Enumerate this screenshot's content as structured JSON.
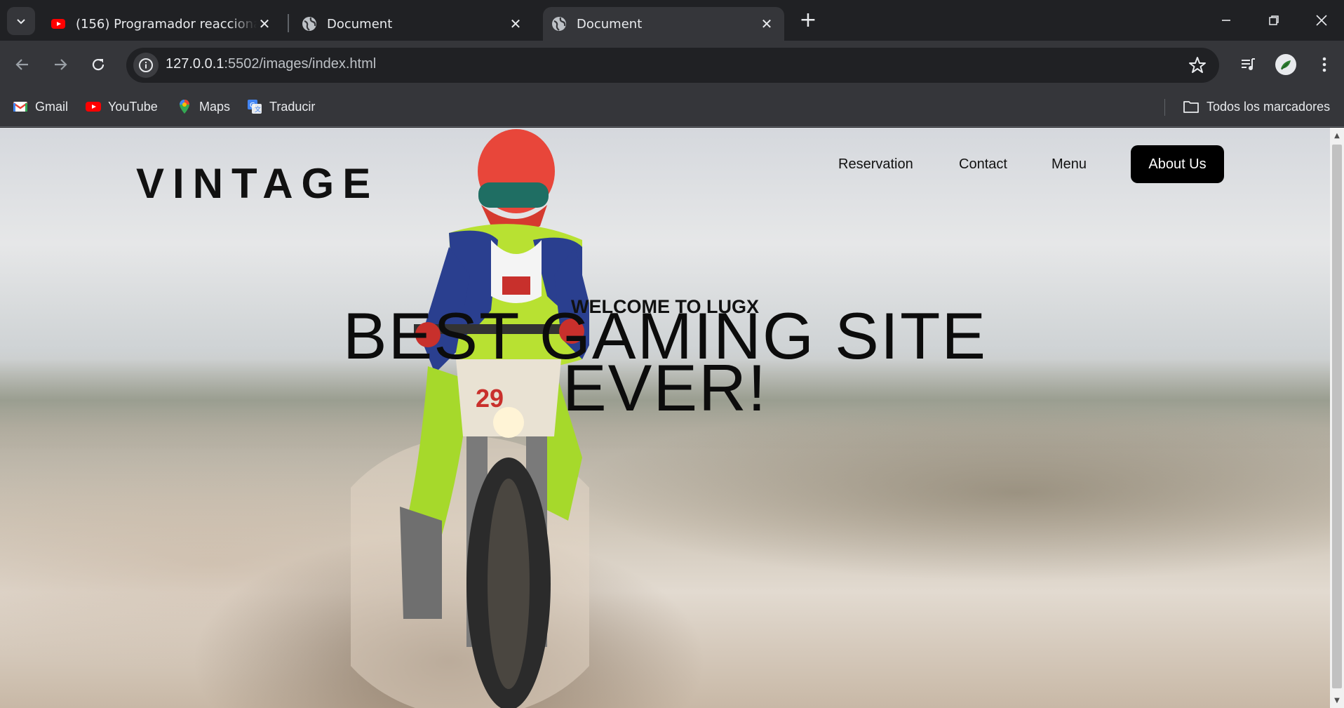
{
  "browser": {
    "tabs": [
      {
        "title": "(156) Programador reacciona a",
        "favicon": "youtube-icon",
        "active": false
      },
      {
        "title": "Document",
        "favicon": "globe-icon",
        "active": false
      },
      {
        "title": "Document",
        "favicon": "globe-icon",
        "active": true
      }
    ],
    "url": {
      "host": "127.0.0.1",
      "rest": ":5502/images/index.html"
    },
    "bookmarks": [
      {
        "label": "Gmail",
        "icon": "gmail-icon"
      },
      {
        "label": "YouTube",
        "icon": "youtube-icon"
      },
      {
        "label": "Maps",
        "icon": "maps-icon"
      },
      {
        "label": "Traducir",
        "icon": "translate-icon"
      }
    ],
    "all_bookmarks_label": "Todos los marcadores",
    "colors": {
      "frame": "#202124",
      "toolbar": "#35363a",
      "text": "#e8eaed"
    }
  },
  "site": {
    "logo": "VINTAGE",
    "nav": [
      "Reservation",
      "Contact",
      "Menu"
    ],
    "nav_cta": "About Us",
    "welcome": "WELCOME TO LUGX",
    "headline_line1": "BEST GAMING SITE",
    "headline_line2": "EVER!",
    "colors": {
      "cta_bg": "#000000",
      "cta_text": "#ffffff",
      "text": "#111111"
    }
  }
}
